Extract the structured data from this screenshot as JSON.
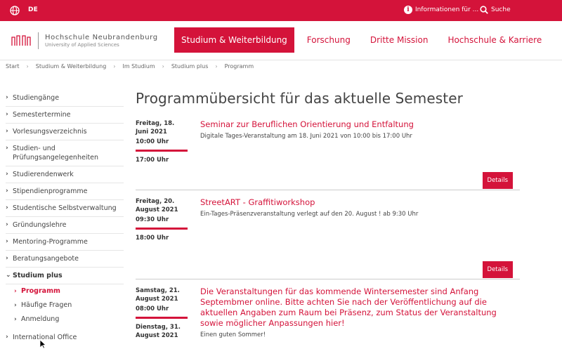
{
  "topbar": {
    "lang": "DE",
    "info_label": "Informationen für ...",
    "search_label": "Suche"
  },
  "header": {
    "logo_name": "Hochschule Neubrandenburg",
    "logo_sub": "University of Applied Sciences",
    "nav": [
      {
        "label": "Studium & Weiterbildung",
        "active": true
      },
      {
        "label": "Forschung",
        "active": false
      },
      {
        "label": "Dritte Mission",
        "active": false
      },
      {
        "label": "Hochschule & Karriere",
        "active": false
      }
    ]
  },
  "breadcrumb": [
    "Start",
    "Studium & Weiterbildung",
    "Im Studium",
    "Studium plus",
    "Programm"
  ],
  "sidebar": {
    "items": [
      {
        "label": "Studiengänge"
      },
      {
        "label": "Semestertermine"
      },
      {
        "label": "Vorlesungsverzeichnis"
      },
      {
        "label": "Studien- und Prüfungsangelegenheiten"
      },
      {
        "label": "Studierendenwerk"
      },
      {
        "label": "Stipendienprogramme"
      },
      {
        "label": "Studentische Selbstverwaltung"
      },
      {
        "label": "Gründungslehre"
      },
      {
        "label": "Mentoring-Programme"
      },
      {
        "label": "Beratungsangebote"
      },
      {
        "label": "Studium plus"
      }
    ],
    "sub_items": [
      {
        "label": "Programm",
        "active": true
      },
      {
        "label": "Häufige Fragen",
        "active": false
      },
      {
        "label": "Anmeldung",
        "active": false
      }
    ],
    "after": {
      "label": "International Office"
    }
  },
  "main": {
    "title": "Programmübersicht für das aktuelle Semester",
    "details_label": "Details",
    "events": [
      {
        "date_start": "Freitag, 18. Juni 2021",
        "time_start": "10:00 Uhr",
        "time_end": "17:00 Uhr",
        "title": "Seminar zur Beruflichen Orientierung und Entfaltung",
        "desc": "Digitale Tages-Veranstaltung am 18. Juni 2021 von 10:00 bis 17:00 Uhr"
      },
      {
        "date_start": "Freitag, 20. August 2021",
        "time_start": "09:30 Uhr",
        "time_end": "18:00 Uhr",
        "title": "StreetART - Graffitiworkshop",
        "desc": "Ein-Tages-Präsenzveranstaltung verlegt auf den 20. August ! ab 9:30 Uhr"
      },
      {
        "date_start": "Samstag, 21. August 2021",
        "time_start": "08:00 Uhr",
        "date_end": "Dienstag, 31. August 2021",
        "title": "Die Veranstaltungen für das kommende Wintersemester sind Anfang Septembmer online. Bitte achten Sie nach der Veröffentlichung auf die aktuellen Angaben zum Raum bei Präsenz, zum Status der Veranstaltung sowie möglicher Anpassungen hier!",
        "desc": "Einen guten Sommer!"
      }
    ]
  },
  "colors": {
    "accent": "#d4133a"
  }
}
